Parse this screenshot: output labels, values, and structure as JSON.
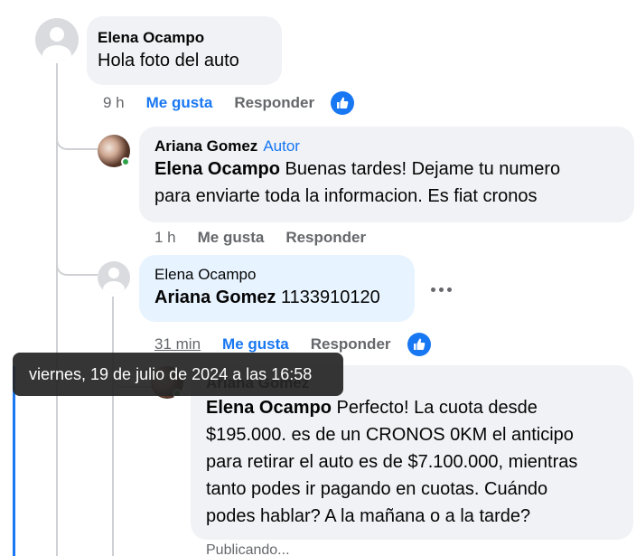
{
  "comment1": {
    "author": "Elena Ocampo",
    "text": "Hola foto del auto",
    "time": "9 h",
    "like": "Me gusta",
    "reply": "Responder"
  },
  "comment2": {
    "author": "Ariana Gomez",
    "badge": "Autor",
    "mention": "Elena Ocampo",
    "text_line1": " Buenas tardes! Dejame tu numero",
    "text_line2": "para enviarte toda la informacion. Es fiat cronos",
    "time": "1 h",
    "like": "Me gusta",
    "reply": "Responder"
  },
  "comment3": {
    "author": "Elena Ocampo",
    "mention": "Ariana Gomez",
    "text": " 1133910120",
    "time": "31 min",
    "like": "Me gusta",
    "reply": "Responder"
  },
  "comment4": {
    "author": "Ariana Gomez",
    "mention": "Elena Ocampo",
    "line1": " Perfecto! La cuota desde",
    "line2": "$195.000. es de un CRONOS 0KM el anticipo",
    "line3": "para retirar el auto es de $7.100.000, mientras",
    "line4": "tanto podes ir pagando en cuotas. Cuándo",
    "line5": "podes hablar? A la mañana o a la tarde?",
    "status": "Publicando..."
  },
  "tooltip": "viernes, 19 de julio de 2024 a las 16:58",
  "icons": {
    "like_reaction": "thumbs-up-icon",
    "more": "more-options-icon"
  },
  "colors": {
    "accent": "#1877f2",
    "online": "#31a24c",
    "bubble": "#f0f2f5",
    "highlight_bubble": "#e7f3ff"
  }
}
